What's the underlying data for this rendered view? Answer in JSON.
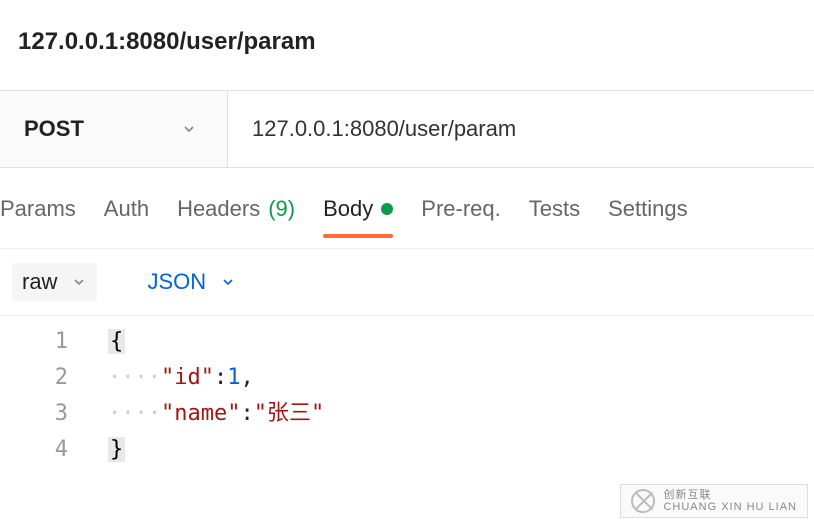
{
  "title": "127.0.0.1:8080/user/param",
  "request": {
    "method": "POST",
    "url": "127.0.0.1:8080/user/param"
  },
  "tabs": {
    "params": "Params",
    "auth": "Auth",
    "headers_label": "Headers",
    "headers_count": "(9)",
    "body": "Body",
    "prereq": "Pre-req.",
    "tests": "Tests",
    "settings": "Settings"
  },
  "subtabs": {
    "raw": "raw",
    "format": "JSON"
  },
  "editor": {
    "line_numbers": [
      "1",
      "2",
      "3",
      "4"
    ],
    "line1_brace": "{",
    "line2_dots": "····",
    "line2_key": "\"id\"",
    "line2_colon": ":",
    "line2_val": "1",
    "line2_comma": ",",
    "line3_dots": "····",
    "line3_key": "\"name\"",
    "line3_colon": ":",
    "line3_val": "\"张三\"",
    "line4_brace": "}"
  },
  "watermark": {
    "line1": "创新互联",
    "line2": "CHUANG XIN HU LIAN"
  }
}
